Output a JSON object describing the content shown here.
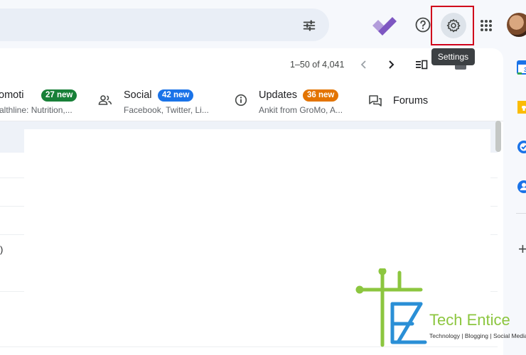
{
  "tooltip": {
    "settings": "Settings"
  },
  "pager": {
    "range": "1–50 of 4,041"
  },
  "tabs": [
    {
      "title": "omoti",
      "badge": "27 new",
      "badge_color": "#188038",
      "subtitle": "althline: Nutrition,..."
    },
    {
      "title": "Social",
      "badge": "42 new",
      "badge_color": "#1a73e8",
      "subtitle": "Facebook, Twitter, Li..."
    },
    {
      "title": "Updates",
      "badge": "36 new",
      "badge_color": "#e37400",
      "subtitle": "Ankit from GroMo, A..."
    },
    {
      "title": "Forums"
    }
  ],
  "row_fragment": ")",
  "watermark": {
    "title": "Tech Entice",
    "tagline": "Technology | Blogging | Social Media"
  },
  "colors": {
    "accent_highlight": "#d0021b",
    "search_bg": "#e9eef6",
    "watermark_green": "#8cc63f",
    "watermark_blue": "#2a8fd6"
  },
  "icons": {
    "filter": "tune-sliders-icon",
    "tasks": "purple-check-icon",
    "help": "help-circle-icon",
    "settings": "gear-icon",
    "apps": "apps-grid-icon",
    "calendar": "calendar-icon",
    "keep": "keep-icon",
    "task_side": "tasks-icon",
    "contacts": "contacts-icon"
  }
}
